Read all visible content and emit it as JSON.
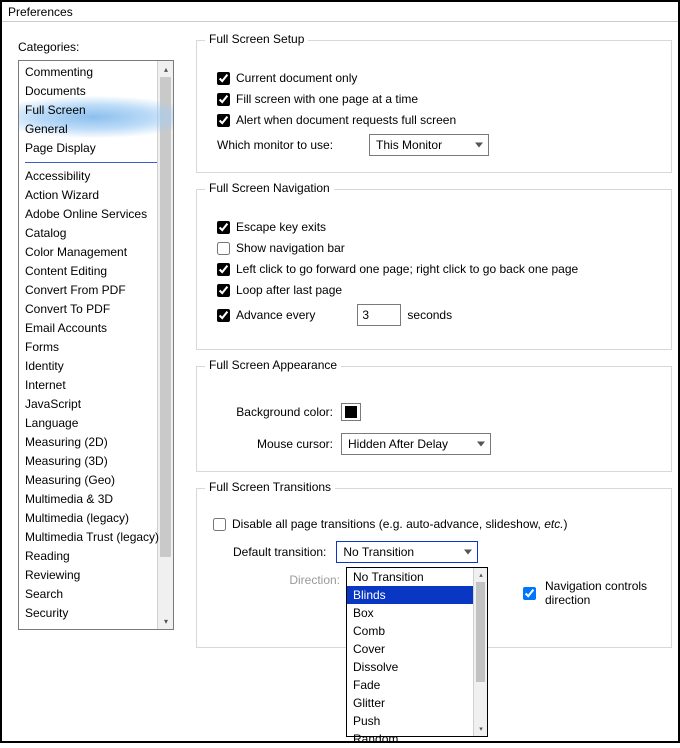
{
  "window_title": "Preferences",
  "categories_label": "Categories:",
  "categories": [
    "Commenting",
    "Documents",
    "Full Screen",
    "General",
    "Page Display",
    "---",
    "Accessibility",
    "Action Wizard",
    "Adobe Online Services",
    "Catalog",
    "Color Management",
    "Content Editing",
    "Convert From PDF",
    "Convert To PDF",
    "Email Accounts",
    "Forms",
    "Identity",
    "Internet",
    "JavaScript",
    "Language",
    "Measuring (2D)",
    "Measuring (3D)",
    "Measuring (Geo)",
    "Multimedia & 3D",
    "Multimedia (legacy)",
    "Multimedia Trust (legacy)",
    "Reading",
    "Reviewing",
    "Search",
    "Security"
  ],
  "selected_category_index": 2,
  "group_setup": {
    "legend": "Full Screen Setup",
    "opt_current_doc": {
      "label": "Current document only",
      "checked": true
    },
    "opt_fill_screen": {
      "label": "Fill screen with one page at a time",
      "checked": true
    },
    "opt_alert": {
      "label": "Alert when document requests full screen",
      "checked": true
    },
    "monitor_label": "Which monitor to use:",
    "monitor_value": "This Monitor"
  },
  "group_nav": {
    "legend": "Full Screen Navigation",
    "opt_esc": {
      "label": "Escape key exits",
      "checked": true
    },
    "opt_navbar": {
      "label": "Show navigation bar",
      "checked": false
    },
    "opt_click": {
      "label": "Left click to go forward one page; right click to go back one page",
      "checked": true
    },
    "opt_loop": {
      "label": "Loop after last page",
      "checked": true
    },
    "opt_advance": {
      "label": "Advance every",
      "checked": true
    },
    "advance_value": "3",
    "advance_unit": "seconds"
  },
  "group_appearance": {
    "legend": "Full Screen Appearance",
    "bg_label": "Background color:",
    "bg_color": "#000000",
    "cursor_label": "Mouse cursor:",
    "cursor_value": "Hidden After Delay"
  },
  "group_trans": {
    "legend": "Full Screen Transitions",
    "opt_disable": {
      "label": "Disable all page transitions (e.g. auto-advance, slideshow, ",
      "italic": "etc.",
      "tail": ")",
      "checked": false
    },
    "default_label": "Default transition:",
    "default_value": "No Transition",
    "direction_label": "Direction:",
    "nav_controls": {
      "label": "Navigation controls direction",
      "checked": true
    },
    "dropdown_options": [
      "No Transition",
      "Blinds",
      "Box",
      "Comb",
      "Cover",
      "Dissolve",
      "Fade",
      "Glitter",
      "Push",
      "Random"
    ],
    "dropdown_selected_index": 1
  }
}
